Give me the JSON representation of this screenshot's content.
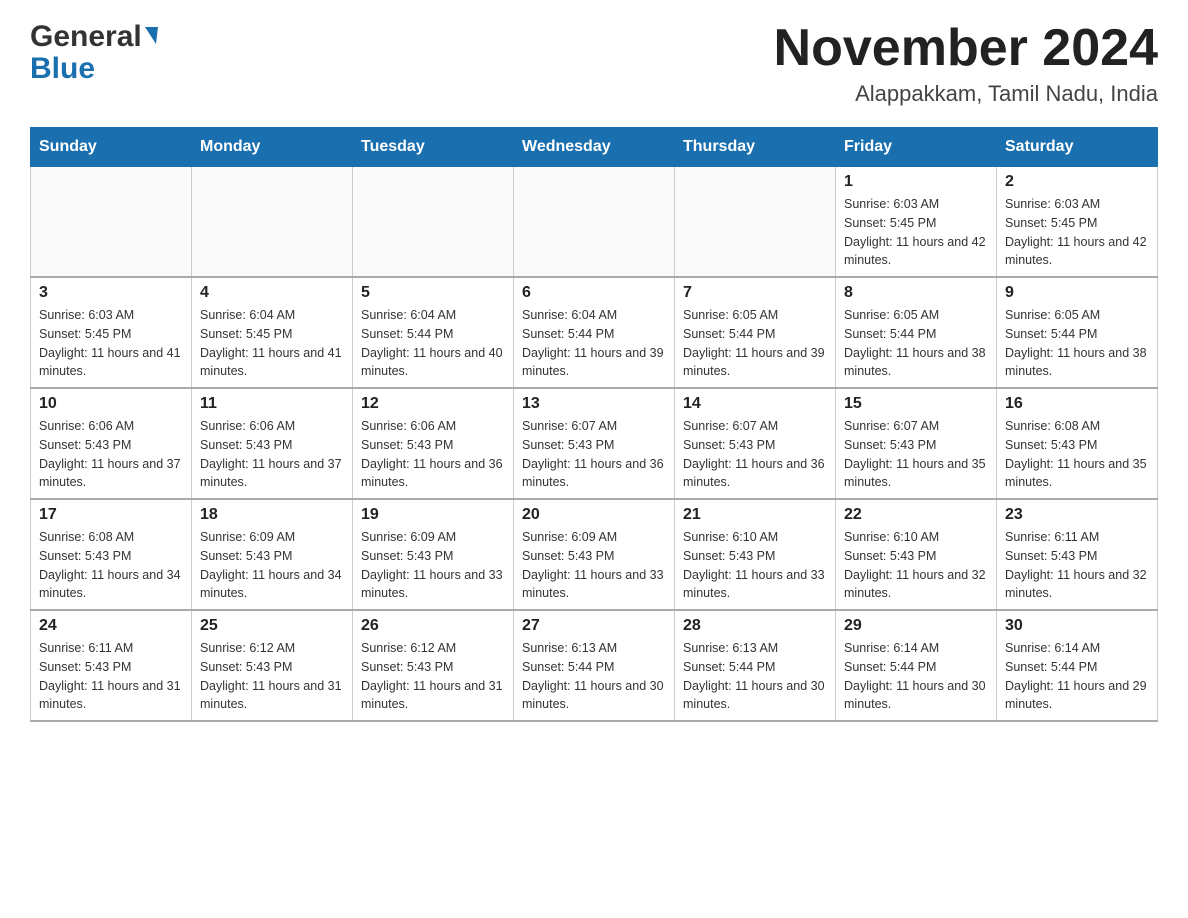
{
  "header": {
    "logo_general": "General",
    "logo_blue": "Blue",
    "month_title": "November 2024",
    "location": "Alappakkam, Tamil Nadu, India"
  },
  "weekdays": [
    "Sunday",
    "Monday",
    "Tuesday",
    "Wednesday",
    "Thursday",
    "Friday",
    "Saturday"
  ],
  "weeks": [
    [
      {
        "day": "",
        "sunrise": "",
        "sunset": "",
        "daylight": ""
      },
      {
        "day": "",
        "sunrise": "",
        "sunset": "",
        "daylight": ""
      },
      {
        "day": "",
        "sunrise": "",
        "sunset": "",
        "daylight": ""
      },
      {
        "day": "",
        "sunrise": "",
        "sunset": "",
        "daylight": ""
      },
      {
        "day": "",
        "sunrise": "",
        "sunset": "",
        "daylight": ""
      },
      {
        "day": "1",
        "sunrise": "Sunrise: 6:03 AM",
        "sunset": "Sunset: 5:45 PM",
        "daylight": "Daylight: 11 hours and 42 minutes."
      },
      {
        "day": "2",
        "sunrise": "Sunrise: 6:03 AM",
        "sunset": "Sunset: 5:45 PM",
        "daylight": "Daylight: 11 hours and 42 minutes."
      }
    ],
    [
      {
        "day": "3",
        "sunrise": "Sunrise: 6:03 AM",
        "sunset": "Sunset: 5:45 PM",
        "daylight": "Daylight: 11 hours and 41 minutes."
      },
      {
        "day": "4",
        "sunrise": "Sunrise: 6:04 AM",
        "sunset": "Sunset: 5:45 PM",
        "daylight": "Daylight: 11 hours and 41 minutes."
      },
      {
        "day": "5",
        "sunrise": "Sunrise: 6:04 AM",
        "sunset": "Sunset: 5:44 PM",
        "daylight": "Daylight: 11 hours and 40 minutes."
      },
      {
        "day": "6",
        "sunrise": "Sunrise: 6:04 AM",
        "sunset": "Sunset: 5:44 PM",
        "daylight": "Daylight: 11 hours and 39 minutes."
      },
      {
        "day": "7",
        "sunrise": "Sunrise: 6:05 AM",
        "sunset": "Sunset: 5:44 PM",
        "daylight": "Daylight: 11 hours and 39 minutes."
      },
      {
        "day": "8",
        "sunrise": "Sunrise: 6:05 AM",
        "sunset": "Sunset: 5:44 PM",
        "daylight": "Daylight: 11 hours and 38 minutes."
      },
      {
        "day": "9",
        "sunrise": "Sunrise: 6:05 AM",
        "sunset": "Sunset: 5:44 PM",
        "daylight": "Daylight: 11 hours and 38 minutes."
      }
    ],
    [
      {
        "day": "10",
        "sunrise": "Sunrise: 6:06 AM",
        "sunset": "Sunset: 5:43 PM",
        "daylight": "Daylight: 11 hours and 37 minutes."
      },
      {
        "day": "11",
        "sunrise": "Sunrise: 6:06 AM",
        "sunset": "Sunset: 5:43 PM",
        "daylight": "Daylight: 11 hours and 37 minutes."
      },
      {
        "day": "12",
        "sunrise": "Sunrise: 6:06 AM",
        "sunset": "Sunset: 5:43 PM",
        "daylight": "Daylight: 11 hours and 36 minutes."
      },
      {
        "day": "13",
        "sunrise": "Sunrise: 6:07 AM",
        "sunset": "Sunset: 5:43 PM",
        "daylight": "Daylight: 11 hours and 36 minutes."
      },
      {
        "day": "14",
        "sunrise": "Sunrise: 6:07 AM",
        "sunset": "Sunset: 5:43 PM",
        "daylight": "Daylight: 11 hours and 36 minutes."
      },
      {
        "day": "15",
        "sunrise": "Sunrise: 6:07 AM",
        "sunset": "Sunset: 5:43 PM",
        "daylight": "Daylight: 11 hours and 35 minutes."
      },
      {
        "day": "16",
        "sunrise": "Sunrise: 6:08 AM",
        "sunset": "Sunset: 5:43 PM",
        "daylight": "Daylight: 11 hours and 35 minutes."
      }
    ],
    [
      {
        "day": "17",
        "sunrise": "Sunrise: 6:08 AM",
        "sunset": "Sunset: 5:43 PM",
        "daylight": "Daylight: 11 hours and 34 minutes."
      },
      {
        "day": "18",
        "sunrise": "Sunrise: 6:09 AM",
        "sunset": "Sunset: 5:43 PM",
        "daylight": "Daylight: 11 hours and 34 minutes."
      },
      {
        "day": "19",
        "sunrise": "Sunrise: 6:09 AM",
        "sunset": "Sunset: 5:43 PM",
        "daylight": "Daylight: 11 hours and 33 minutes."
      },
      {
        "day": "20",
        "sunrise": "Sunrise: 6:09 AM",
        "sunset": "Sunset: 5:43 PM",
        "daylight": "Daylight: 11 hours and 33 minutes."
      },
      {
        "day": "21",
        "sunrise": "Sunrise: 6:10 AM",
        "sunset": "Sunset: 5:43 PM",
        "daylight": "Daylight: 11 hours and 33 minutes."
      },
      {
        "day": "22",
        "sunrise": "Sunrise: 6:10 AM",
        "sunset": "Sunset: 5:43 PM",
        "daylight": "Daylight: 11 hours and 32 minutes."
      },
      {
        "day": "23",
        "sunrise": "Sunrise: 6:11 AM",
        "sunset": "Sunset: 5:43 PM",
        "daylight": "Daylight: 11 hours and 32 minutes."
      }
    ],
    [
      {
        "day": "24",
        "sunrise": "Sunrise: 6:11 AM",
        "sunset": "Sunset: 5:43 PM",
        "daylight": "Daylight: 11 hours and 31 minutes."
      },
      {
        "day": "25",
        "sunrise": "Sunrise: 6:12 AM",
        "sunset": "Sunset: 5:43 PM",
        "daylight": "Daylight: 11 hours and 31 minutes."
      },
      {
        "day": "26",
        "sunrise": "Sunrise: 6:12 AM",
        "sunset": "Sunset: 5:43 PM",
        "daylight": "Daylight: 11 hours and 31 minutes."
      },
      {
        "day": "27",
        "sunrise": "Sunrise: 6:13 AM",
        "sunset": "Sunset: 5:44 PM",
        "daylight": "Daylight: 11 hours and 30 minutes."
      },
      {
        "day": "28",
        "sunrise": "Sunrise: 6:13 AM",
        "sunset": "Sunset: 5:44 PM",
        "daylight": "Daylight: 11 hours and 30 minutes."
      },
      {
        "day": "29",
        "sunrise": "Sunrise: 6:14 AM",
        "sunset": "Sunset: 5:44 PM",
        "daylight": "Daylight: 11 hours and 30 minutes."
      },
      {
        "day": "30",
        "sunrise": "Sunrise: 6:14 AM",
        "sunset": "Sunset: 5:44 PM",
        "daylight": "Daylight: 11 hours and 29 minutes."
      }
    ]
  ]
}
